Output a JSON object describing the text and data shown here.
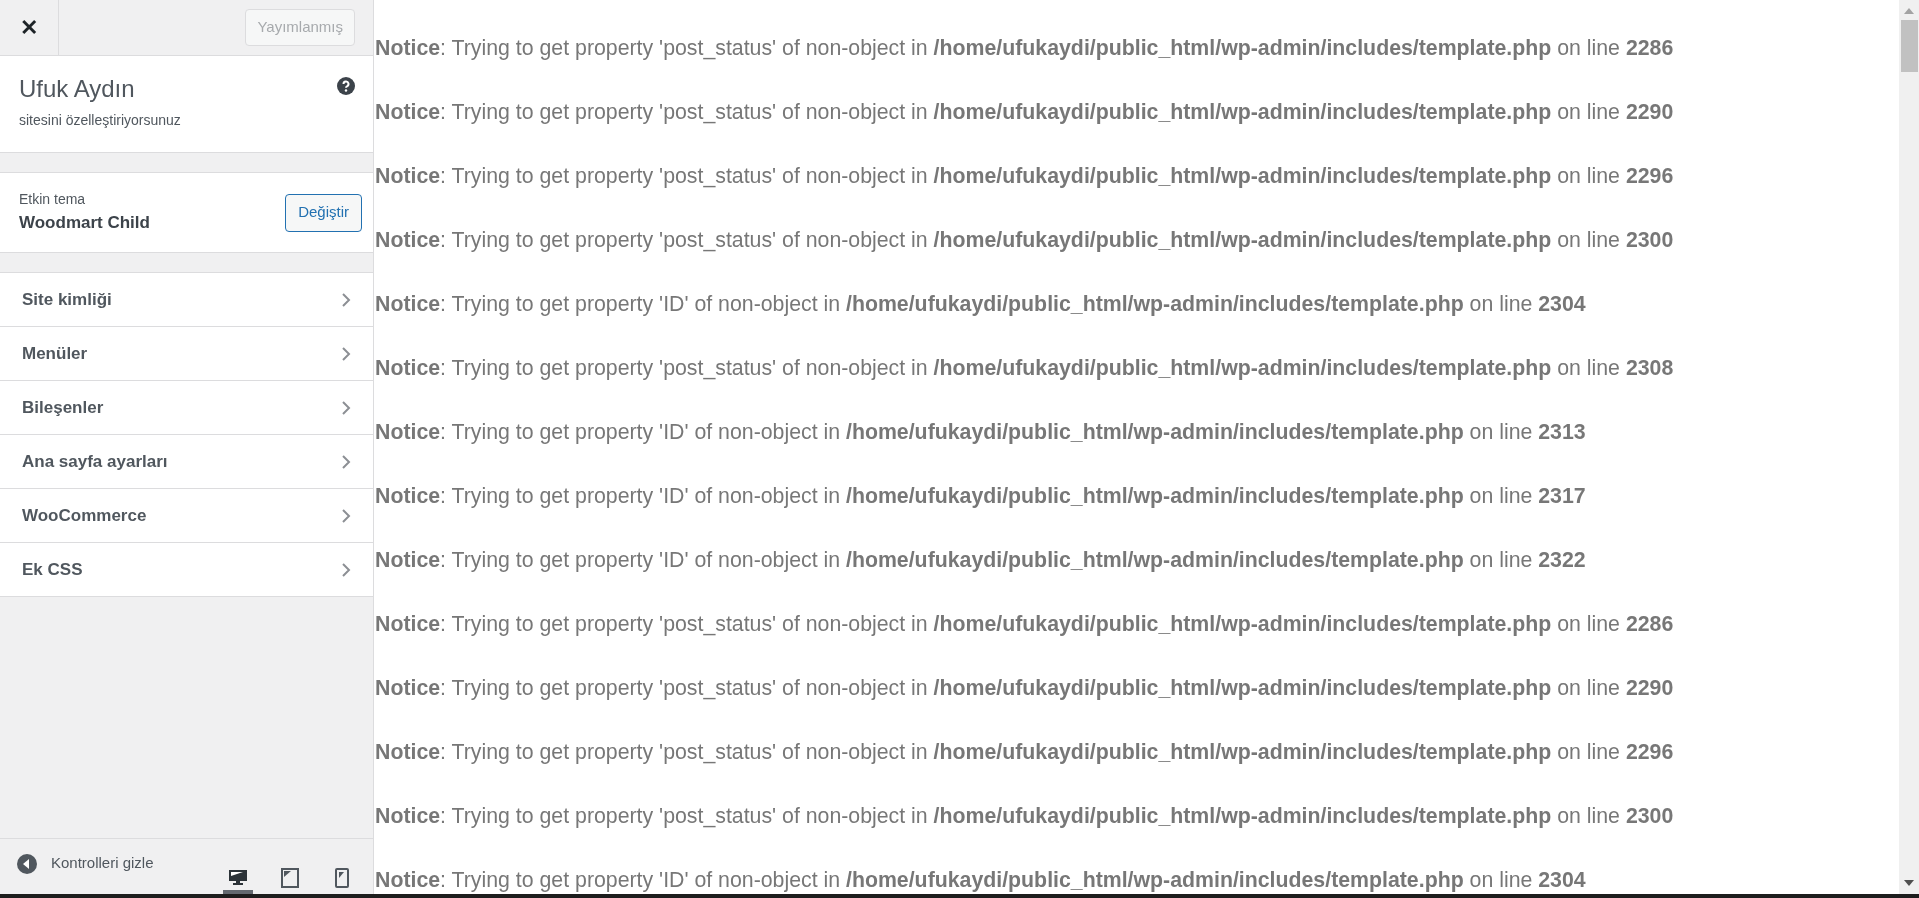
{
  "header": {
    "close": "✕",
    "publish_button": "Yayımlanmış"
  },
  "site": {
    "title": "Ufuk Aydın",
    "subtitle": "sitesini özelleştiriyorsunuz"
  },
  "theme": {
    "label": "Etkin tema",
    "name": "Woodmart Child",
    "change_button": "Değiştir"
  },
  "sections": [
    {
      "label": "Site kimliği"
    },
    {
      "label": "Menüler"
    },
    {
      "label": "Bileşenler"
    },
    {
      "label": "Ana sayfa ayarları"
    },
    {
      "label": "WooCommerce"
    },
    {
      "label": "Ek CSS"
    }
  ],
  "footer": {
    "hide_controls": "Kontrolleri gizle",
    "devices": [
      {
        "kind": "desktop",
        "selected": true
      },
      {
        "kind": "tablet",
        "selected": false
      },
      {
        "kind": "mobile",
        "selected": false
      }
    ]
  },
  "notices": [
    "**Notice**: Trying to get property 'post_status' of non-object in **/home/ufukaydi/public_html/wp-admin/includes/template.php** on line **2286**",
    "**Notice**: Trying to get property 'post_status' of non-object in **/home/ufukaydi/public_html/wp-admin/includes/template.php** on line **2290**",
    "**Notice**: Trying to get property 'post_status' of non-object in **/home/ufukaydi/public_html/wp-admin/includes/template.php** on line **2296**",
    "**Notice**: Trying to get property 'post_status' of non-object in **/home/ufukaydi/public_html/wp-admin/includes/template.php** on line **2300**",
    "**Notice**: Trying to get property 'ID' of non-object in **/home/ufukaydi/public_html/wp-admin/includes/template.php** on line **2304**",
    "**Notice**: Trying to get property 'post_status' of non-object in **/home/ufukaydi/public_html/wp-admin/includes/template.php** on line **2308**",
    "**Notice**: Trying to get property 'ID' of non-object in **/home/ufukaydi/public_html/wp-admin/includes/template.php** on line **2313**",
    "**Notice**: Trying to get property 'ID' of non-object in **/home/ufukaydi/public_html/wp-admin/includes/template.php** on line **2317**",
    "**Notice**: Trying to get property 'ID' of non-object in **/home/ufukaydi/public_html/wp-admin/includes/template.php** on line **2322**",
    "**Notice**: Trying to get property 'post_status' of non-object in **/home/ufukaydi/public_html/wp-admin/includes/template.php** on line **2286**",
    "**Notice**: Trying to get property 'post_status' of non-object in **/home/ufukaydi/public_html/wp-admin/includes/template.php** on line **2290**",
    "**Notice**: Trying to get property 'post_status' of non-object in **/home/ufukaydi/public_html/wp-admin/includes/template.php** on line **2296**",
    "**Notice**: Trying to get property 'post_status' of non-object in **/home/ufukaydi/public_html/wp-admin/includes/template.php** on line **2300**",
    "**Notice**: Trying to get property 'ID' of non-object in **/home/ufukaydi/public_html/wp-admin/includes/template.php** on line **2304**"
  ]
}
